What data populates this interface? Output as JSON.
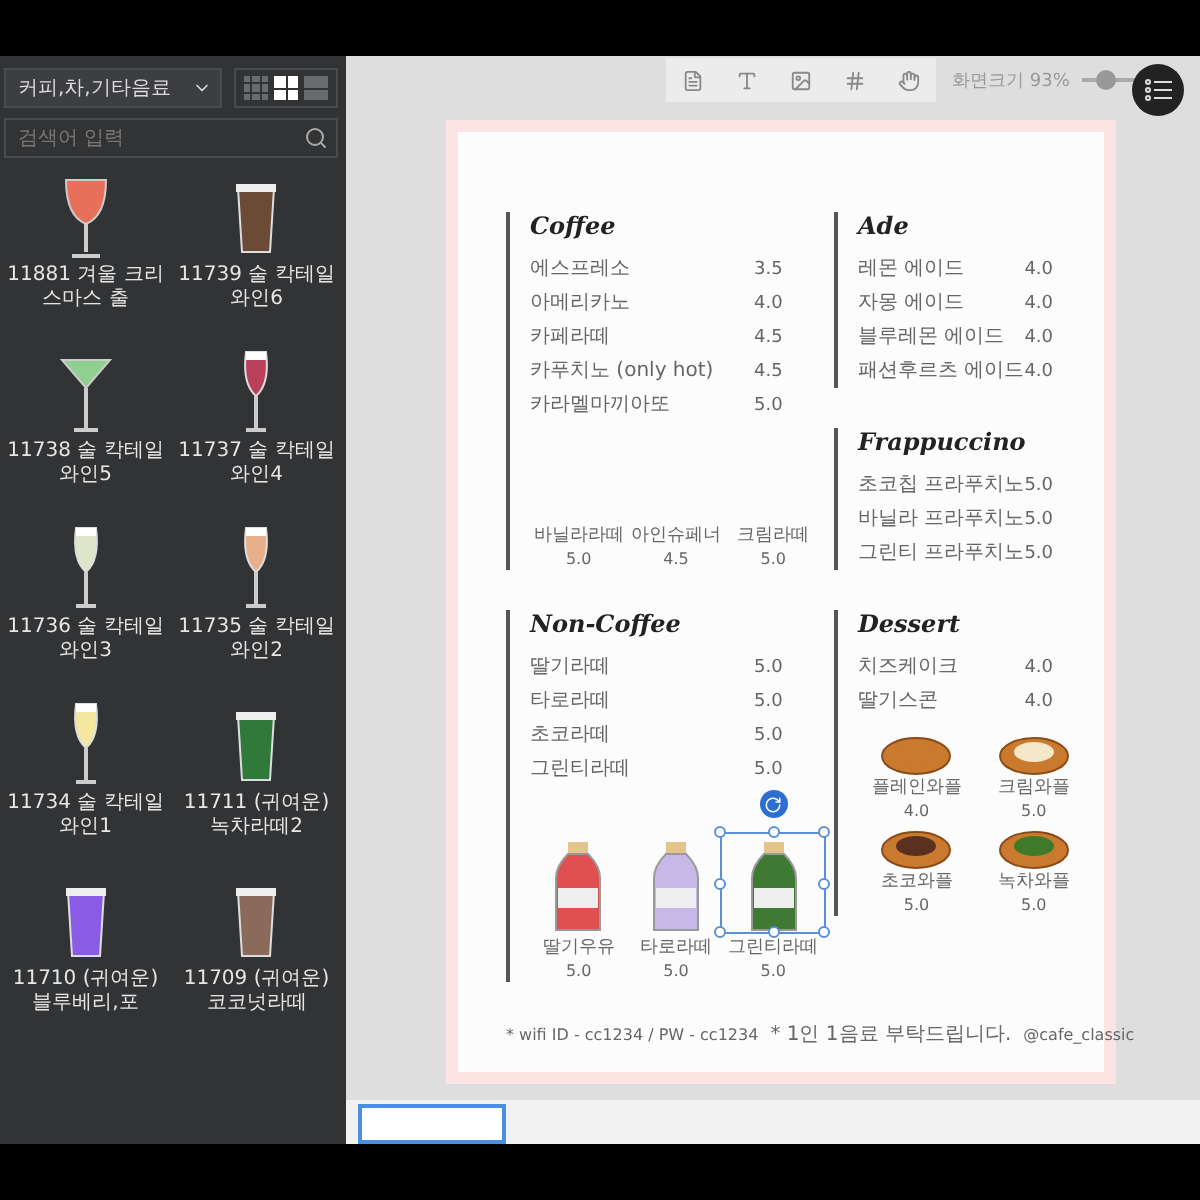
{
  "sidebar": {
    "category": "커피,차,기타음료",
    "view_modes": [
      {
        "kind": "small-grid",
        "selected": false
      },
      {
        "kind": "large-grid",
        "selected": true
      },
      {
        "kind": "list",
        "selected": false
      }
    ],
    "search": {
      "placeholder": "검색어 입력"
    },
    "items": [
      {
        "label": "11881 겨울 크리스마스 출",
        "kind": "goblet",
        "color": "#e8705a"
      },
      {
        "label": "11739 술 칵테일 와인6",
        "kind": "cup",
        "color": "#6b4a36"
      },
      {
        "label": "11738 술 칵테일 와인5",
        "kind": "martini",
        "color": "#8fcf8f"
      },
      {
        "label": "11737 술 칵테일 와인4",
        "kind": "wine",
        "color": "#b8405a"
      },
      {
        "label": "11736 술 칵테일 와인3",
        "kind": "wine",
        "color": "#dde6c8"
      },
      {
        "label": "11735 술 칵테일 와인2",
        "kind": "wine",
        "color": "#e8b08a"
      },
      {
        "label": "11734 술 칵테일 와인1",
        "kind": "wine",
        "color": "#f5e7a0"
      },
      {
        "label": "11711 (귀여운)녹차라떼2",
        "kind": "cup",
        "color": "#2f7a3a"
      },
      {
        "label": "11710 (귀여운)블루베리,포",
        "kind": "cup",
        "color": "#8a5ce6"
      },
      {
        "label": "11709 (귀여운)코코넛라떼",
        "kind": "cup",
        "color": "#8a6a5a"
      }
    ]
  },
  "toolbar": {
    "zoom": {
      "label": "화면크기 93%",
      "level": 0.3
    }
  },
  "menu": {
    "columns": [
      [
        {
          "title": "Coffee",
          "items": [
            {
              "name": "에스프레소",
              "price": "3.5"
            },
            {
              "name": "아메리카노",
              "price": "4.0"
            },
            {
              "name": "카페라떼",
              "price": "4.5"
            },
            {
              "name": "카푸치노 (only hot)",
              "price": "4.5"
            },
            {
              "name": "카라멜마끼아또",
              "price": "5.0"
            }
          ],
          "extras": [
            {
              "kind": "text",
              "name": "바닐라라떼",
              "price": "5.0"
            },
            {
              "kind": "text",
              "name": "아인슈페너",
              "price": "4.5"
            },
            {
              "kind": "text",
              "name": "크림라떼",
              "price": "5.0"
            }
          ]
        },
        {
          "title": "Non-Coffee",
          "items": [
            {
              "name": "딸기라떼",
              "price": "5.0"
            },
            {
              "name": "타로라떼",
              "price": "5.0"
            },
            {
              "name": "초코라떼",
              "price": "5.0"
            },
            {
              "name": "그린티라떼",
              "price": "5.0"
            }
          ],
          "extras": [
            {
              "kind": "bottle",
              "name": "딸기우유",
              "price": "5.0",
              "color": "#e05050",
              "selected": false
            },
            {
              "kind": "bottle",
              "name": "타로라떼",
              "price": "5.0",
              "color": "#c8b8e8",
              "selected": false
            },
            {
              "kind": "bottle",
              "name": "그린티라떼",
              "price": "5.0",
              "color": "#3f7a35",
              "selected": true
            }
          ]
        }
      ],
      [
        {
          "title": "Ade",
          "items": [
            {
              "name": "레몬 에이드",
              "price": "4.0"
            },
            {
              "name": "자몽 에이드",
              "price": "4.0"
            },
            {
              "name": "블루레몬 에이드",
              "price": "4.0"
            },
            {
              "name": "패션후르츠 에이드",
              "price": "4.0"
            }
          ]
        },
        {
          "title": "Frappuccino",
          "items": [
            {
              "name": "초코칩 프라푸치노",
              "price": "5.0"
            },
            {
              "name": "바닐라 프라푸치노",
              "price": "5.0"
            },
            {
              "name": "그린티 프라푸치노",
              "price": "5.0"
            }
          ]
        },
        {
          "title": "Dessert",
          "items": [
            {
              "name": "치즈케이크",
              "price": "4.0"
            },
            {
              "name": "딸기스콘",
              "price": "4.0"
            }
          ],
          "extras": [
            {
              "kind": "waffle",
              "name": "플레인와플",
              "price": "4.0",
              "color": "#c97a2e"
            },
            {
              "kind": "waffle",
              "name": "크림와플",
              "price": "5.0",
              "color": "#f5e8c8"
            },
            {
              "kind": "waffle",
              "name": "초코와플",
              "price": "5.0",
              "color": "#5a3020"
            },
            {
              "kind": "waffle",
              "name": "녹차와플",
              "price": "5.0",
              "color": "#3f7a2a"
            }
          ]
        }
      ]
    ],
    "footer": [
      "* wifi ID - cc1234 / PW - cc1234",
      "* 1인 1음료 부탁드립니다.",
      "@cafe_classic"
    ]
  },
  "thumbnails": [
    {
      "selected": true
    }
  ]
}
